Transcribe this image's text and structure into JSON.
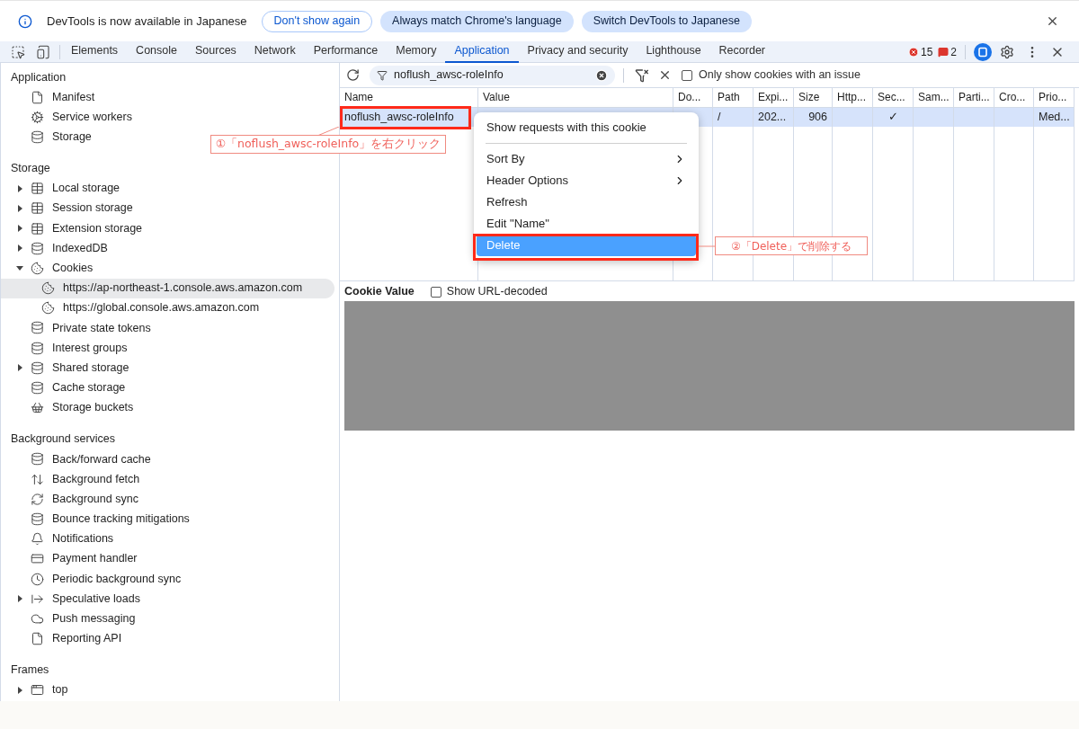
{
  "banner": {
    "message": "DevTools is now available in Japanese",
    "buttons": [
      {
        "label": "Don't show again",
        "kind": "outline"
      },
      {
        "label": "Always match Chrome's language",
        "kind": "filled"
      },
      {
        "label": "Switch DevTools to Japanese",
        "kind": "filled"
      }
    ]
  },
  "tabs": [
    {
      "label": "Elements",
      "selected": false
    },
    {
      "label": "Console",
      "selected": false
    },
    {
      "label": "Sources",
      "selected": false
    },
    {
      "label": "Network",
      "selected": false
    },
    {
      "label": "Performance",
      "selected": false
    },
    {
      "label": "Memory",
      "selected": false
    },
    {
      "label": "Application",
      "selected": true
    },
    {
      "label": "Privacy and security",
      "selected": false
    },
    {
      "label": "Lighthouse",
      "selected": false
    },
    {
      "label": "Recorder",
      "selected": false
    }
  ],
  "counters": {
    "errors": "15",
    "issues": "2"
  },
  "sidebar": {
    "sections": [
      {
        "title": "Application",
        "items": [
          {
            "label": "Manifest",
            "kind": "file",
            "selected": false
          },
          {
            "label": "Service workers",
            "kind": "gears",
            "selected": false
          },
          {
            "label": "Storage",
            "kind": "database",
            "selected": false
          }
        ]
      },
      {
        "title": "Storage",
        "items": [
          {
            "label": "Local storage",
            "kind": "grid",
            "expanded": false,
            "selected": false
          },
          {
            "label": "Session storage",
            "kind": "grid",
            "expanded": false,
            "selected": false
          },
          {
            "label": "Extension storage",
            "kind": "grid",
            "expanded": false,
            "selected": false
          },
          {
            "label": "IndexedDB",
            "kind": "database",
            "expanded": false,
            "selected": false
          },
          {
            "label": "Cookies",
            "kind": "cookie",
            "expanded": true,
            "selected": false,
            "children": [
              {
                "label": "https://ap-northeast-1.console.aws.amazon.com",
                "kind": "cookie",
                "selected": true
              },
              {
                "label": "https://global.console.aws.amazon.com",
                "kind": "cookie",
                "selected": false
              }
            ]
          },
          {
            "label": "Private state tokens",
            "kind": "database",
            "selected": false
          },
          {
            "label": "Interest groups",
            "kind": "database",
            "selected": false
          },
          {
            "label": "Shared storage",
            "kind": "database",
            "expanded": false,
            "selected": false
          },
          {
            "label": "Cache storage",
            "kind": "database",
            "selected": false
          },
          {
            "label": "Storage buckets",
            "kind": "bucket",
            "selected": false
          }
        ]
      },
      {
        "title": "Background services",
        "items": [
          {
            "label": "Back/forward cache",
            "kind": "database",
            "selected": false
          },
          {
            "label": "Background fetch",
            "kind": "updown",
            "selected": false
          },
          {
            "label": "Background sync",
            "kind": "sync",
            "selected": false
          },
          {
            "label": "Bounce tracking mitigations",
            "kind": "database",
            "selected": false
          },
          {
            "label": "Notifications",
            "kind": "bell",
            "selected": false
          },
          {
            "label": "Payment handler",
            "kind": "card",
            "selected": false
          },
          {
            "label": "Periodic background sync",
            "kind": "clock",
            "selected": false
          },
          {
            "label": "Speculative loads",
            "kind": "arrow",
            "expanded": false,
            "selected": false
          },
          {
            "label": "Push messaging",
            "kind": "cloud",
            "selected": false
          },
          {
            "label": "Reporting API",
            "kind": "file",
            "selected": false
          }
        ]
      },
      {
        "title": "Frames",
        "items": [
          {
            "label": "top",
            "kind": "frame",
            "expanded": false,
            "selected": false
          }
        ]
      }
    ]
  },
  "filter": {
    "value": "noflush_awsc-roleInfo",
    "only_issues": {
      "label": "Only show cookies with an issue",
      "checked": false
    }
  },
  "table": {
    "columns": [
      "Name",
      "Value",
      "Do...",
      "Path",
      "Expi...",
      "Size",
      "Http...",
      "Sec...",
      "Sam...",
      "Parti...",
      "Cro...",
      "Prio..."
    ],
    "rows": [
      {
        "selected": true,
        "highlighted": true,
        "cells": [
          "noflush_awsc-roleInfo",
          null,
          null,
          "/",
          "202...",
          "906",
          null,
          "✓",
          null,
          null,
          null,
          "Med..."
        ]
      }
    ]
  },
  "context_menu": {
    "items": [
      {
        "kind": "item",
        "label": "Show requests with this cookie",
        "selected": false
      },
      {
        "kind": "separator"
      },
      {
        "kind": "submenu",
        "label": "Sort By",
        "selected": false
      },
      {
        "kind": "submenu",
        "label": "Header Options",
        "selected": false
      },
      {
        "kind": "item",
        "label": "Refresh",
        "selected": false
      },
      {
        "kind": "item",
        "label": "Edit \"Name\"",
        "selected": false
      },
      {
        "kind": "item",
        "label": "Delete",
        "selected": true
      }
    ]
  },
  "cookie_value": {
    "title": "Cookie Value",
    "show_url_decoded": {
      "label": "Show URL-decoded",
      "checked": false
    }
  },
  "annotations": [
    {
      "text": "①「noflush_awsc-roleInfo」を右クリック"
    },
    {
      "text": "②「Delete」で削除する"
    }
  ]
}
